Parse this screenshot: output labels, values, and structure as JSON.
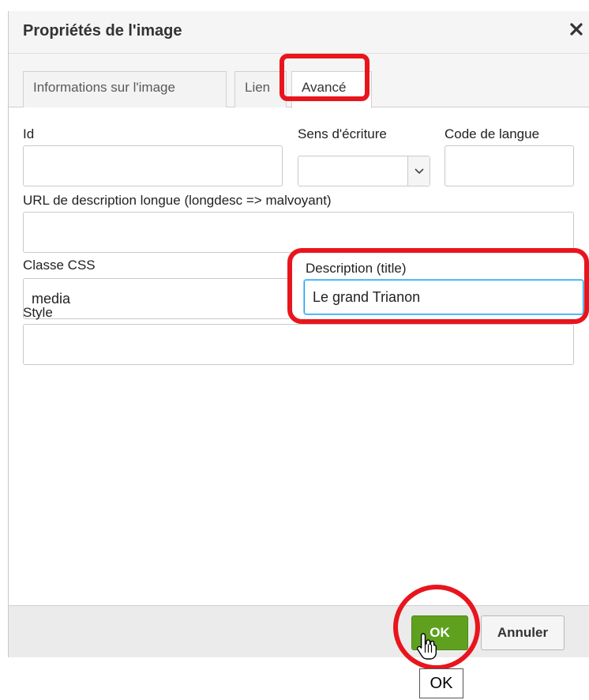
{
  "dialog": {
    "title": "Propriétés de l'image",
    "close_glyph": "✕"
  },
  "tabs": [
    {
      "label": "Informations sur l'image",
      "active": false
    },
    {
      "label": "Lien",
      "active": false
    },
    {
      "label": "Avancé",
      "active": true
    }
  ],
  "fields": {
    "id": {
      "label": "Id",
      "value": ""
    },
    "direction": {
      "label": "Sens d'écriture",
      "value": ""
    },
    "lang_code": {
      "label": "Code de langue",
      "value": ""
    },
    "longdesc": {
      "label": "URL de description longue (longdesc => malvoyant)",
      "value": ""
    },
    "css_class": {
      "label": "Classe CSS",
      "value": "media"
    },
    "title": {
      "label": "Description (title)",
      "value": "Le grand Trianon"
    },
    "style": {
      "label": "Style",
      "value": ""
    }
  },
  "buttons": {
    "ok": "OK",
    "cancel": "Annuler"
  },
  "tooltip": "OK",
  "colors": {
    "annotation": "#e8151d",
    "ok_button": "#5fa11f",
    "focus_border": "#139ff7"
  }
}
